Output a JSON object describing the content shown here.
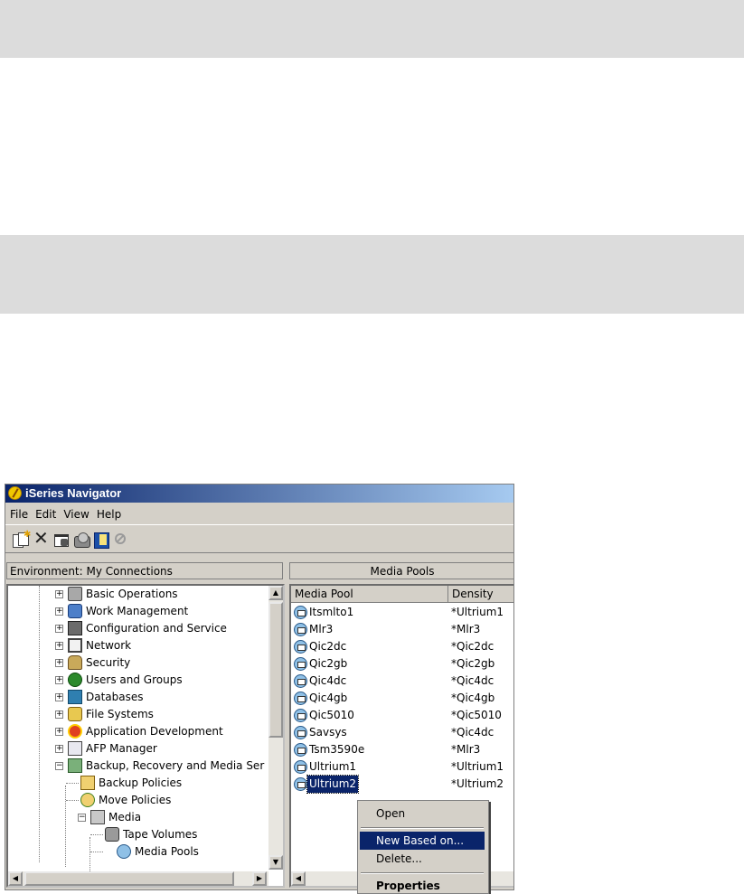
{
  "window": {
    "title": "iSeries Navigator"
  },
  "menu": [
    "File",
    "Edit",
    "View",
    "Help"
  ],
  "toolbar": {
    "icons": [
      "new-based-on-icon",
      "delete-icon",
      "properties-icon",
      "tape-icon",
      "task-pad-icon",
      "stop-icon"
    ]
  },
  "left_header": "Environment: My Connections",
  "right_header": "Media Pools",
  "tree": [
    {
      "label": "Basic Operations",
      "icon": "basic-operations-icon",
      "expander": "+"
    },
    {
      "label": "Work Management",
      "icon": "work-management-icon",
      "expander": "+"
    },
    {
      "label": "Configuration and Service",
      "icon": "configuration-service-icon",
      "expander": "+"
    },
    {
      "label": "Network",
      "icon": "network-icon",
      "expander": "+"
    },
    {
      "label": "Security",
      "icon": "security-icon",
      "expander": "+"
    },
    {
      "label": "Users and Groups",
      "icon": "users-groups-icon",
      "expander": "+"
    },
    {
      "label": "Databases",
      "icon": "databases-icon",
      "expander": "+"
    },
    {
      "label": "File Systems",
      "icon": "file-systems-icon",
      "expander": "+"
    },
    {
      "label": "Application Development",
      "icon": "application-development-icon",
      "expander": "+"
    },
    {
      "label": "AFP Manager",
      "icon": "afp-manager-icon",
      "expander": "+"
    },
    {
      "label": "Backup, Recovery and Media Ser",
      "icon": "backup-recovery-icon",
      "expander": "−"
    },
    {
      "label": "Backup Policies",
      "icon": "backup-policies-icon"
    },
    {
      "label": "Move Policies",
      "icon": "move-policies-icon"
    },
    {
      "label": "Media",
      "icon": "media-icon",
      "expander": "−"
    },
    {
      "label": "Tape Volumes",
      "icon": "tape-volumes-icon"
    },
    {
      "label": "Media Pools",
      "icon": "media-pools-icon"
    }
  ],
  "list": {
    "columns": [
      "Media Pool",
      "Density"
    ],
    "rows": [
      {
        "name": "Itsmlto1",
        "density": "*Ultrium1"
      },
      {
        "name": "Mlr3",
        "density": "*Mlr3"
      },
      {
        "name": "Qic2dc",
        "density": "*Qic2dc"
      },
      {
        "name": "Qic2gb",
        "density": "*Qic2gb"
      },
      {
        "name": "Qic4dc",
        "density": "*Qic4dc"
      },
      {
        "name": "Qic4gb",
        "density": "*Qic4gb"
      },
      {
        "name": "Qic5010",
        "density": "*Qic5010"
      },
      {
        "name": "Savsys",
        "density": "*Qic4dc"
      },
      {
        "name": "Tsm3590e",
        "density": "*Mlr3"
      },
      {
        "name": "Ultrium1",
        "density": "*Ultrium1"
      },
      {
        "name": "Ultrium2",
        "density": "*Ultrium2"
      }
    ],
    "selected": "Ultrium2"
  },
  "context_menu": [
    "Open",
    "New Based on...",
    "Delete...",
    "Properties"
  ],
  "colors": {
    "titlebar": "#0a246a",
    "selection": "#0a246a",
    "chrome": "#d4d0c8",
    "band": "#dcdcdc"
  }
}
